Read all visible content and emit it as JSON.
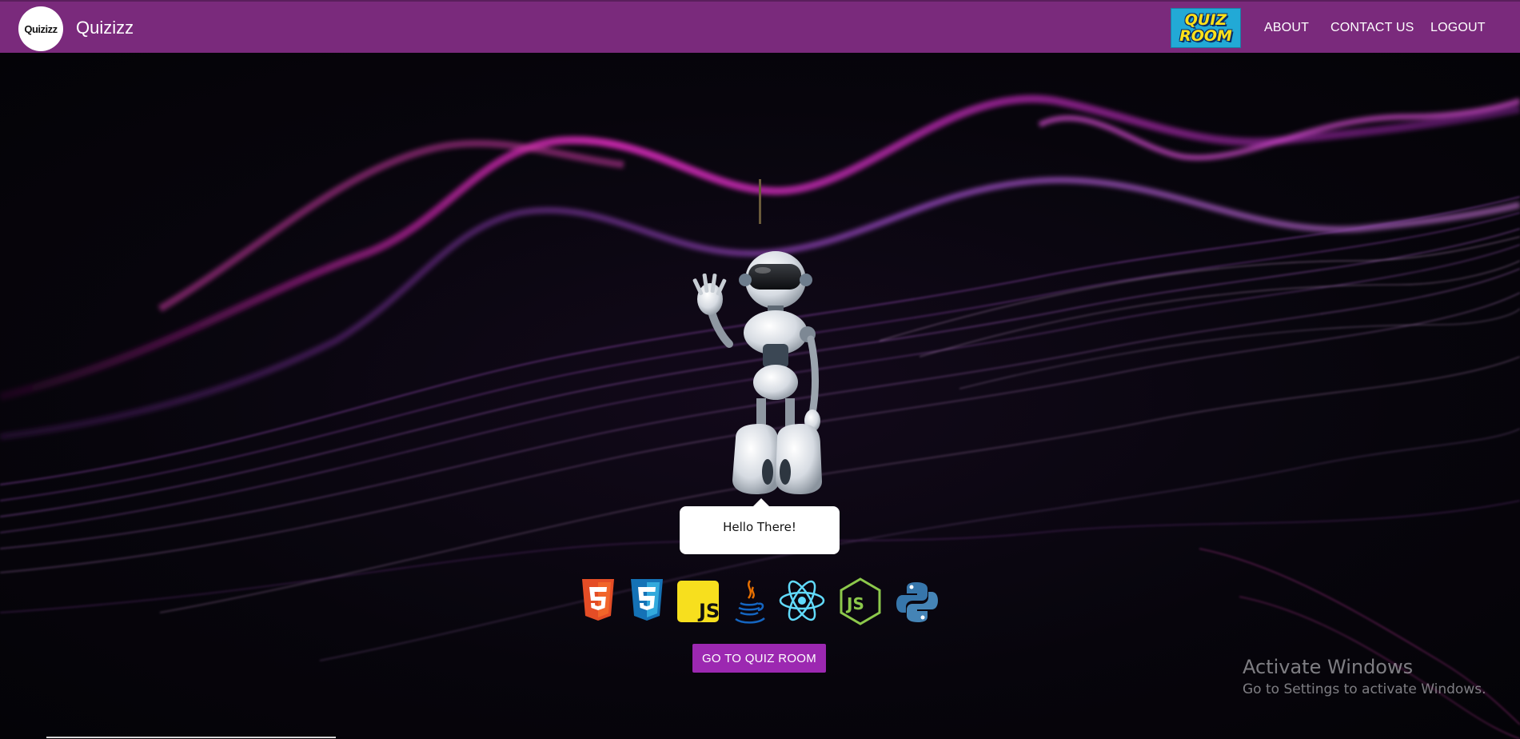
{
  "navbar": {
    "brand_logo_text": "Quizizz",
    "brand_name": "Quizizz",
    "quiz_room_logo": [
      "QUIZ",
      "ROOM"
    ],
    "links": {
      "about": "ABOUT",
      "contact": "CONTACT US",
      "logout": "LOGOUT"
    },
    "background_color": "#7a2a7c"
  },
  "hero": {
    "speech_bubble": "Hello There!",
    "tech_icons": [
      "html5-icon",
      "css3-icon",
      "javascript-icon",
      "java-icon",
      "react-icon",
      "nodejs-icon",
      "python-icon"
    ],
    "button_label": "GO TO QUIZ ROOM",
    "button_color": "#9c28b1"
  },
  "watermark": {
    "title": "Activate Windows",
    "subtitle": "Go to Settings to activate Windows."
  }
}
